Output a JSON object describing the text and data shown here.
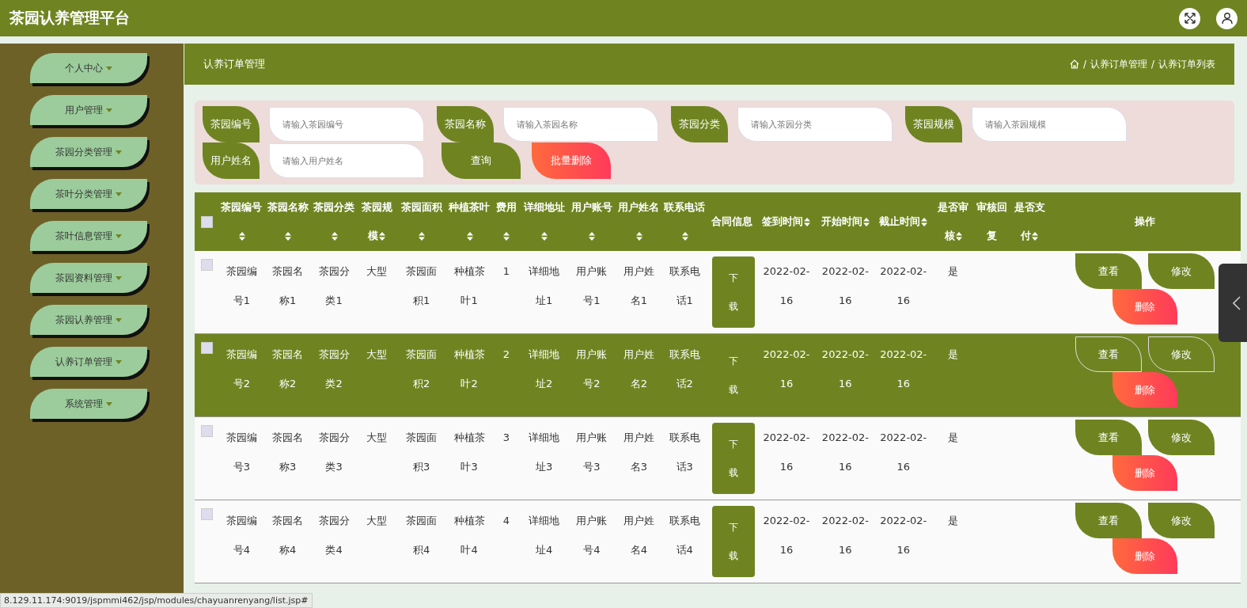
{
  "app_title": "茶园认养管理平台",
  "sidebar": {
    "items": [
      {
        "label": "个人中心"
      },
      {
        "label": "用户管理"
      },
      {
        "label": "茶园分类管理"
      },
      {
        "label": "茶叶分类管理"
      },
      {
        "label": "茶叶信息管理"
      },
      {
        "label": "茶园资料管理"
      },
      {
        "label": "茶园认养管理"
      },
      {
        "label": "认养订单管理"
      },
      {
        "label": "系统管理"
      }
    ]
  },
  "page_title": "认养订单管理",
  "breadcrumb": [
    {
      "separator": "/",
      "label": "认养订单管理"
    },
    {
      "separator": "/",
      "label": "认养订单列表"
    }
  ],
  "search": {
    "fields": [
      {
        "label": "茶园编号",
        "placeholder": "请输入茶园编号"
      },
      {
        "label": "茶园名称",
        "placeholder": "请输入茶园名称"
      },
      {
        "label": "茶园分类",
        "placeholder": "请输入茶园分类"
      },
      {
        "label": "茶园规模",
        "placeholder": "请输入茶园规模"
      },
      {
        "label": "用户姓名",
        "placeholder": "请输入用户姓名"
      }
    ],
    "buttons": [
      {
        "label": "查询",
        "kind": "query"
      },
      {
        "label": "批量删除",
        "kind": "danger"
      }
    ]
  },
  "table": {
    "header_checked": false,
    "columns": [
      {
        "label": "茶园编号",
        "sortable": true
      },
      {
        "label": "茶园名称",
        "sortable": true
      },
      {
        "label": "茶园分类",
        "sortable": true
      },
      {
        "label": "茶园规模",
        "sortable": true
      },
      {
        "label": "茶园面积",
        "sortable": true
      },
      {
        "label": "种植茶叶",
        "sortable": true
      },
      {
        "label": "费用",
        "sortable": true
      },
      {
        "label": "详细地址",
        "sortable": true
      },
      {
        "label": "用户账号",
        "sortable": true
      },
      {
        "label": "用户姓名",
        "sortable": true
      },
      {
        "label": "联系电话",
        "sortable": true
      },
      {
        "label": "合同信息",
        "sortable": false
      },
      {
        "label": "签到时间",
        "sortable": true
      },
      {
        "label": "开始时间",
        "sortable": true
      },
      {
        "label": "截止时间",
        "sortable": true
      },
      {
        "label": "是否审核",
        "sortable": true
      },
      {
        "label": "审核回复",
        "sortable": false
      },
      {
        "label": "是否支付",
        "sortable": true
      },
      {
        "label": "操作",
        "sortable": false
      }
    ],
    "rows": [
      {
        "highlighted": false,
        "checked": false,
        "cells": [
          {
            "kind": "text",
            "text": "茶园编号1"
          },
          {
            "kind": "text",
            "text": "茶园名称1"
          },
          {
            "kind": "text",
            "text": "茶园分类1"
          },
          {
            "kind": "text",
            "text": "大型"
          },
          {
            "kind": "text",
            "text": "茶园面积1"
          },
          {
            "kind": "text",
            "text": "种植茶叶1"
          },
          {
            "kind": "text",
            "text": "1"
          },
          {
            "kind": "text",
            "text": "详细地址1"
          },
          {
            "kind": "text",
            "text": "用户账号1"
          },
          {
            "kind": "text",
            "text": "用户姓名1"
          },
          {
            "kind": "text",
            "text": "联系电话1"
          },
          {
            "kind": "download",
            "text": "下载"
          },
          {
            "kind": "text",
            "text": "2022-02-16"
          },
          {
            "kind": "text",
            "text": "2022-02-16"
          },
          {
            "kind": "text",
            "text": "2022-02-16"
          },
          {
            "kind": "text",
            "text": "是"
          },
          {
            "kind": "empty"
          },
          {
            "kind": "empty"
          }
        ],
        "actions": [
          {
            "label": "查看",
            "kind": "view"
          },
          {
            "label": "修改",
            "kind": "edit"
          },
          {
            "label": "删除",
            "kind": "delete"
          }
        ]
      },
      {
        "highlighted": true,
        "checked": false,
        "cells": [
          {
            "kind": "text",
            "text": "茶园编号2"
          },
          {
            "kind": "text",
            "text": "茶园名称2"
          },
          {
            "kind": "text",
            "text": "茶园分类2"
          },
          {
            "kind": "text",
            "text": "大型"
          },
          {
            "kind": "text",
            "text": "茶园面积2"
          },
          {
            "kind": "text",
            "text": "种植茶叶2"
          },
          {
            "kind": "text",
            "text": "2"
          },
          {
            "kind": "text",
            "text": "详细地址2"
          },
          {
            "kind": "text",
            "text": "用户账号2"
          },
          {
            "kind": "text",
            "text": "用户姓名2"
          },
          {
            "kind": "text",
            "text": "联系电话2"
          },
          {
            "kind": "download",
            "text": "下载"
          },
          {
            "kind": "text",
            "text": "2022-02-16"
          },
          {
            "kind": "text",
            "text": "2022-02-16"
          },
          {
            "kind": "text",
            "text": "2022-02-16"
          },
          {
            "kind": "text",
            "text": "是"
          },
          {
            "kind": "empty"
          },
          {
            "kind": "empty"
          }
        ],
        "actions": [
          {
            "label": "查看",
            "kind": "view"
          },
          {
            "label": "修改",
            "kind": "edit"
          },
          {
            "label": "删除",
            "kind": "delete"
          }
        ]
      },
      {
        "highlighted": false,
        "checked": false,
        "cells": [
          {
            "kind": "text",
            "text": "茶园编号3"
          },
          {
            "kind": "text",
            "text": "茶园名称3"
          },
          {
            "kind": "text",
            "text": "茶园分类3"
          },
          {
            "kind": "text",
            "text": "大型"
          },
          {
            "kind": "text",
            "text": "茶园面积3"
          },
          {
            "kind": "text",
            "text": "种植茶叶3"
          },
          {
            "kind": "text",
            "text": "3"
          },
          {
            "kind": "text",
            "text": "详细地址3"
          },
          {
            "kind": "text",
            "text": "用户账号3"
          },
          {
            "kind": "text",
            "text": "用户姓名3"
          },
          {
            "kind": "text",
            "text": "联系电话3"
          },
          {
            "kind": "download",
            "text": "下载"
          },
          {
            "kind": "text",
            "text": "2022-02-16"
          },
          {
            "kind": "text",
            "text": "2022-02-16"
          },
          {
            "kind": "text",
            "text": "2022-02-16"
          },
          {
            "kind": "text",
            "text": "是"
          },
          {
            "kind": "empty"
          },
          {
            "kind": "empty"
          }
        ],
        "actions": [
          {
            "label": "查看",
            "kind": "view"
          },
          {
            "label": "修改",
            "kind": "edit"
          },
          {
            "label": "删除",
            "kind": "delete"
          }
        ]
      },
      {
        "highlighted": false,
        "checked": false,
        "cells": [
          {
            "kind": "text",
            "text": "茶园编号4"
          },
          {
            "kind": "text",
            "text": "茶园名称4"
          },
          {
            "kind": "text",
            "text": "茶园分类4"
          },
          {
            "kind": "text",
            "text": "大型"
          },
          {
            "kind": "text",
            "text": "茶园面积4"
          },
          {
            "kind": "text",
            "text": "种植茶叶4"
          },
          {
            "kind": "text",
            "text": "4"
          },
          {
            "kind": "text",
            "text": "详细地址4"
          },
          {
            "kind": "text",
            "text": "用户账号4"
          },
          {
            "kind": "text",
            "text": "用户姓名4"
          },
          {
            "kind": "text",
            "text": "联系电话4"
          },
          {
            "kind": "download",
            "text": "下载"
          },
          {
            "kind": "text",
            "text": "2022-02-16"
          },
          {
            "kind": "text",
            "text": "2022-02-16"
          },
          {
            "kind": "text",
            "text": "2022-02-16"
          },
          {
            "kind": "text",
            "text": "是"
          },
          {
            "kind": "empty"
          },
          {
            "kind": "empty"
          }
        ],
        "actions": [
          {
            "label": "查看",
            "kind": "view"
          },
          {
            "label": "修改",
            "kind": "edit"
          },
          {
            "label": "删除",
            "kind": "delete"
          }
        ]
      }
    ]
  },
  "status_bar": {
    "url": "8.129.11.174:9019/jspmmi462/jsp/modules/chayuanrenyang/list.jsp#"
  }
}
